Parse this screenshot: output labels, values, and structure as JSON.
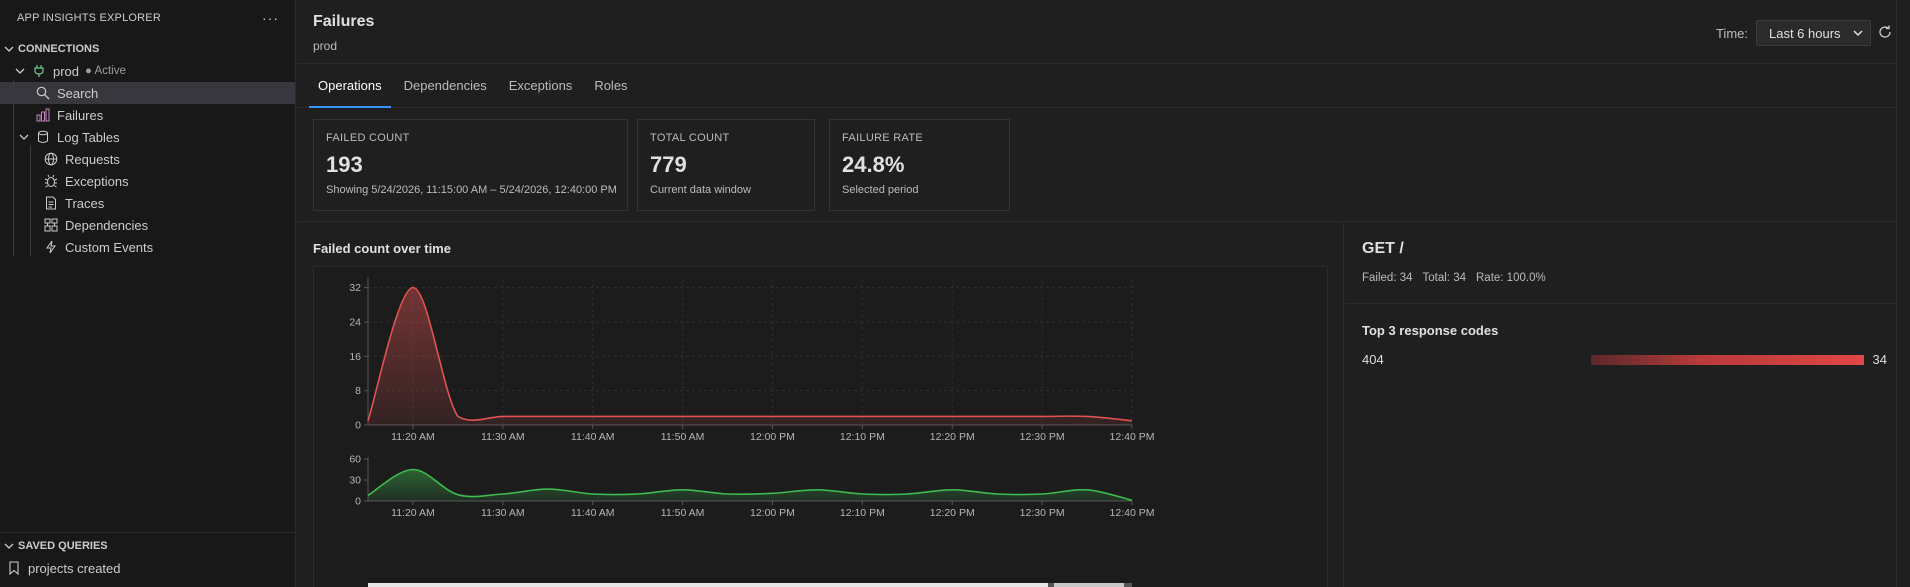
{
  "sidebar": {
    "title": "APP INSIGHTS EXPLORER",
    "more": "···",
    "connections_label": "CONNECTIONS",
    "connection": {
      "name": "prod",
      "status": "● Active"
    },
    "items": [
      {
        "label": "Search",
        "icon": "search-icon"
      },
      {
        "label": "Failures",
        "icon": "bar-chart-icon"
      },
      {
        "label": "Log Tables",
        "icon": "database-icon"
      }
    ],
    "log_tables": [
      {
        "label": "Requests",
        "icon": "globe-icon"
      },
      {
        "label": "Exceptions",
        "icon": "bug-icon"
      },
      {
        "label": "Traces",
        "icon": "document-icon"
      },
      {
        "label": "Dependencies",
        "icon": "dependencies-icon"
      },
      {
        "label": "Custom Events",
        "icon": "lightning-icon"
      }
    ],
    "saved_queries_label": "SAVED QUERIES",
    "saved_queries": [
      {
        "label": "projects created",
        "icon": "bookmark-icon"
      }
    ]
  },
  "header": {
    "title": "Failures",
    "subtitle": "prod",
    "time_label": "Time:",
    "time_value": "Last 6 hours"
  },
  "tabs": [
    {
      "label": "Operations",
      "active": true
    },
    {
      "label": "Dependencies",
      "active": false
    },
    {
      "label": "Exceptions",
      "active": false
    },
    {
      "label": "Roles",
      "active": false
    }
  ],
  "metrics": [
    {
      "label": "FAILED COUNT",
      "value": "193",
      "caption": "Showing 5/24/2026, 11:15:00 AM – 5/24/2026, 12:40:00 PM"
    },
    {
      "label": "TOTAL COUNT",
      "value": "779",
      "caption": "Current data window"
    },
    {
      "label": "FAILURE RATE",
      "value": "24.8%",
      "caption": "Selected period"
    }
  ],
  "chart_title": "Failed count over time",
  "chart_data": [
    {
      "type": "area",
      "color": "#e05252",
      "x": [
        "11:15 AM",
        "11:20 AM",
        "11:25 AM",
        "11:30 AM",
        "11:35 AM",
        "11:40 AM",
        "11:45 AM",
        "11:50 AM",
        "11:55 AM",
        "12:00 PM",
        "12:05 PM",
        "12:10 PM",
        "12:15 PM",
        "12:20 PM",
        "12:25 PM",
        "12:30 PM",
        "12:35 PM",
        "12:40 PM"
      ],
      "values": [
        1,
        32,
        2,
        2,
        2,
        2,
        2,
        2,
        2,
        2,
        2,
        2,
        2,
        2,
        2,
        2,
        2,
        1
      ],
      "ylim": [
        0,
        34
      ],
      "yticks": [
        0,
        8,
        16,
        24,
        32
      ],
      "xticks": [
        "11:20 AM",
        "11:30 AM",
        "11:40 AM",
        "11:50 AM",
        "12:00 PM",
        "12:10 PM",
        "12:20 PM",
        "12:30 PM",
        "12:40 PM"
      ],
      "grid": true
    },
    {
      "type": "area",
      "color": "#3fb950",
      "x": [
        "11:15 AM",
        "11:20 AM",
        "11:25 AM",
        "11:30 AM",
        "11:35 AM",
        "11:40 AM",
        "11:45 AM",
        "11:50 AM",
        "11:55 AM",
        "12:00 PM",
        "12:05 PM",
        "12:10 PM",
        "12:15 PM",
        "12:20 PM",
        "12:25 PM",
        "12:30 PM",
        "12:35 PM",
        "12:40 PM"
      ],
      "values": [
        8,
        45,
        9,
        10,
        17,
        10,
        10,
        16,
        10,
        11,
        16,
        10,
        10,
        16,
        10,
        10,
        16,
        1
      ],
      "ylim": [
        0,
        60
      ],
      "yticks": [
        0,
        30,
        60
      ],
      "xticks": [
        "11:20 AM",
        "11:30 AM",
        "11:40 AM",
        "11:50 AM",
        "12:00 PM",
        "12:10 PM",
        "12:20 PM",
        "12:30 PM",
        "12:40 PM"
      ],
      "grid": false
    }
  ],
  "detail": {
    "title": "GET /",
    "failed": "Failed: 34",
    "total": "Total: 34",
    "rate": "Rate: 100.0%",
    "codes_title": "Top 3 response codes",
    "codes": [
      {
        "code": "404",
        "count": "34",
        "fraction": 1.0
      }
    ]
  }
}
